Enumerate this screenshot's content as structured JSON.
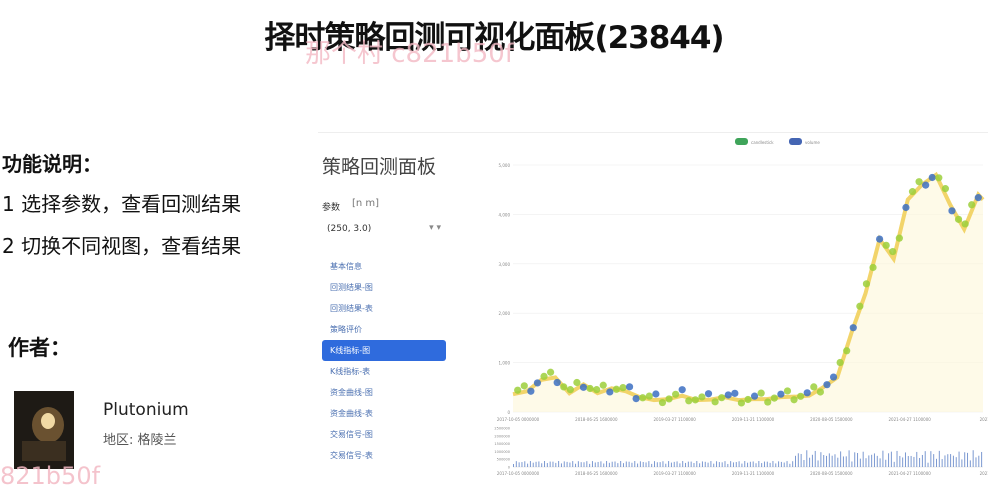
{
  "page": {
    "title": "择时策略回测可视化面板(23844)"
  },
  "watermarks": {
    "top": "那个村 c821b50f",
    "bottom": "821b50f"
  },
  "description": {
    "title": "功能说明：",
    "lines": [
      "1 选择参数，查看回测结果",
      "2 切换不同视图，查看结果"
    ]
  },
  "author": {
    "title": "作者：",
    "name": "Plutonium",
    "region": "地区: 格陵兰"
  },
  "panel": {
    "title": "策略回测面板",
    "param_label": "参数",
    "param_options": "[n   m]",
    "param_value": "(250, 3.0)",
    "menu": [
      "基本信息",
      "回测结果-图",
      "回测结果-表",
      "策略评价",
      "K线指标-图",
      "K线指标-表",
      "资金曲线-图",
      "资金曲线-表",
      "交易信号-图",
      "交易信号-表"
    ],
    "active_menu_index": 4,
    "accent": "#2f6bdd"
  },
  "chart_data": {
    "type": "line",
    "legend": [
      "candlestick",
      "volume"
    ],
    "y_ticks": [
      "0",
      "1,000",
      "2,000",
      "3,000",
      "4,000",
      "5,000"
    ],
    "ylim": [
      0,
      5000
    ],
    "x_ticks": [
      "2017-10-05 0000000",
      "2018-06-25 1600000",
      "2019-03-27 1100000",
      "2019-11-21 1100000",
      "2020-08-05 1500000",
      "2021-04-27 1100000",
      "2021-08"
    ],
    "volume_y_ticks": [
      "0",
      "500000",
      "1000000",
      "1500000",
      "2000000",
      "2500000"
    ],
    "series": [
      {
        "name": "candlestick",
        "x": [
          0,
          3,
          6,
          9,
          12,
          15,
          18,
          21,
          24,
          27,
          30,
          33,
          36,
          39,
          42,
          45,
          48,
          51,
          54,
          57,
          60,
          63,
          66,
          69,
          72,
          75,
          78,
          81,
          84,
          87,
          90,
          93,
          96,
          99,
          100
        ],
        "values": [
          360,
          420,
          650,
          700,
          380,
          560,
          380,
          480,
          420,
          300,
          240,
          260,
          330,
          240,
          250,
          300,
          240,
          260,
          260,
          300,
          310,
          330,
          500,
          700,
          1600,
          2400,
          3500,
          3100,
          4300,
          4600,
          4800,
          4200,
          3700,
          4400,
          4300
        ]
      }
    ],
    "colors": {
      "line": "#f2d46a",
      "marker_up": "#9ccf3b",
      "marker_down": "#3c6ec2",
      "volume": "#5b7fc6"
    }
  }
}
